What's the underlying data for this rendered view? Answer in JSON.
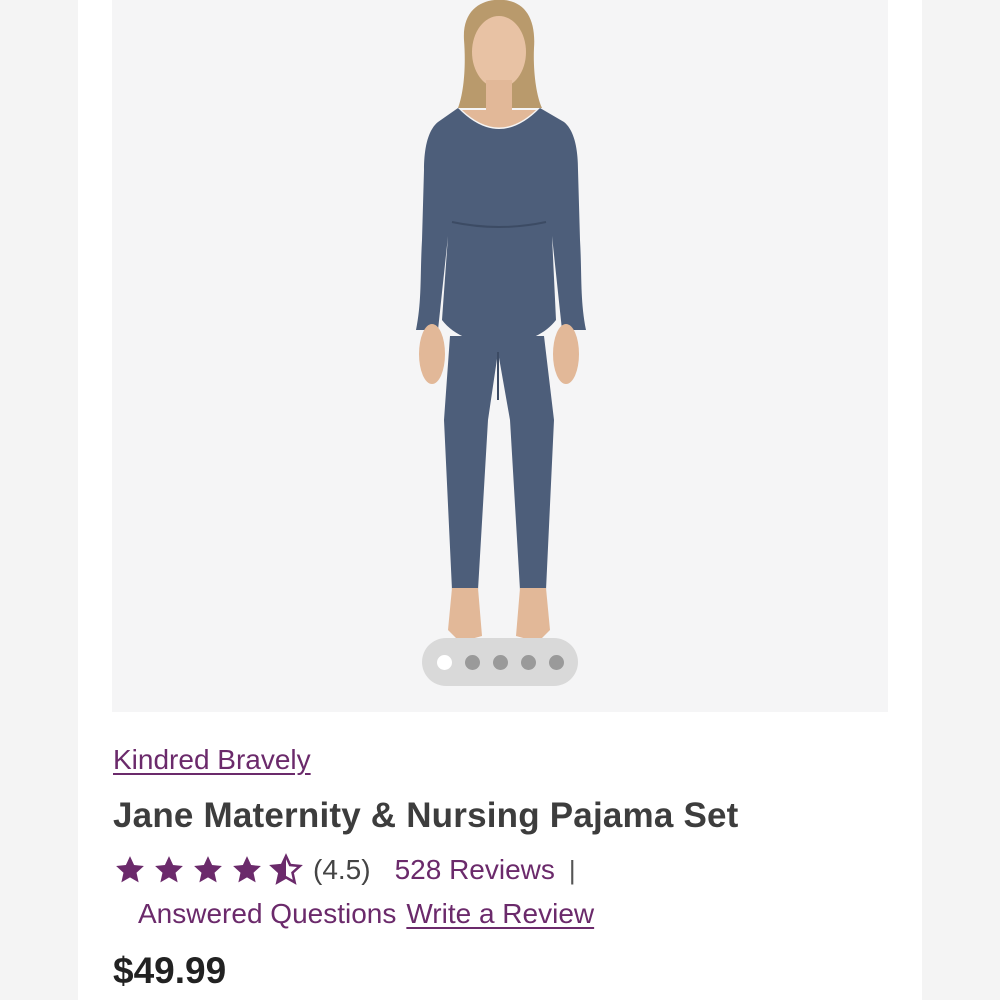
{
  "gallery": {
    "slide_count": 5,
    "active_slide": 1,
    "image_icon": "model-wearing-pajama-set"
  },
  "product": {
    "brand": "Kindred Bravely",
    "title": "Jane Maternity & Nursing Pajama Set",
    "rating_stars": 4.5,
    "rating_text": "(4.5)",
    "reviews_link": "528 Reviews",
    "separator": "|",
    "questions_link": "Answered Questions",
    "write_review_link": "Write a Review",
    "price": "$49.99"
  },
  "colors": {
    "accent": "#6b2a6b",
    "star": "#6b2a6b",
    "garment": "#4d5e7a"
  }
}
